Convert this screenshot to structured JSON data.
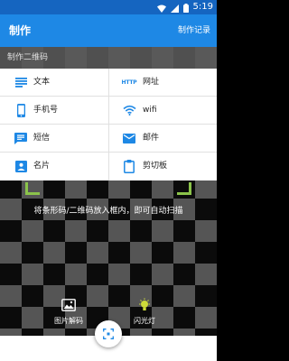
{
  "status_bar": {
    "time": "5:19",
    "icons": [
      "wifi-icon",
      "signal-icon",
      "battery-icon"
    ]
  },
  "app_bar": {
    "title": "制作",
    "action_label": "制作记录"
  },
  "section": {
    "title": "制作二维码"
  },
  "menu": {
    "items": [
      {
        "label": "文本",
        "icon": "text-lines-icon"
      },
      {
        "label": "网址",
        "icon": "http-icon",
        "icon_text": "HTTP"
      },
      {
        "label": "手机号",
        "icon": "phone-icon"
      },
      {
        "label": "wifi",
        "icon": "wifi-icon"
      },
      {
        "label": "短信",
        "icon": "sms-icon"
      },
      {
        "label": "邮件",
        "icon": "email-icon"
      },
      {
        "label": "名片",
        "icon": "contact-card-icon"
      },
      {
        "label": "剪切板",
        "icon": "clipboard-icon"
      }
    ]
  },
  "scanner": {
    "hint": "将条形码/二维码放入框内，即可自动扫描"
  },
  "actions": {
    "decode_label": "图片解码",
    "flash_label": "闪光灯"
  },
  "colors": {
    "primary": "#1e88e5",
    "status_bar": "#1565c0",
    "scan_corner": "#8bc34a"
  }
}
